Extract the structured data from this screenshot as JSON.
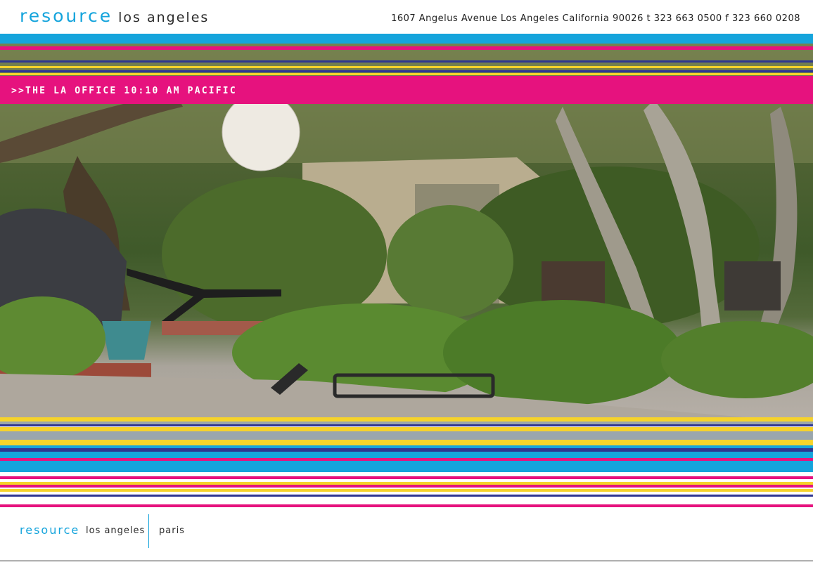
{
  "header": {
    "brand": "resource",
    "city": "los angeles",
    "address": "1607 Angelus Avenue Los Angeles California 90026  t 323 663 0500 f 323 660 0208"
  },
  "banner": {
    "text": ">>THE LA OFFICE  10:10 AM PACIFIC"
  },
  "footer": {
    "brand": "resource",
    "la": "los angeles",
    "paris": "paris"
  },
  "colors": {
    "cyan": "#15a4dc",
    "magenta": "#e6127e",
    "yellow": "#f6d32b",
    "navy": "#2e3591",
    "gray": "#9aa6ad"
  }
}
